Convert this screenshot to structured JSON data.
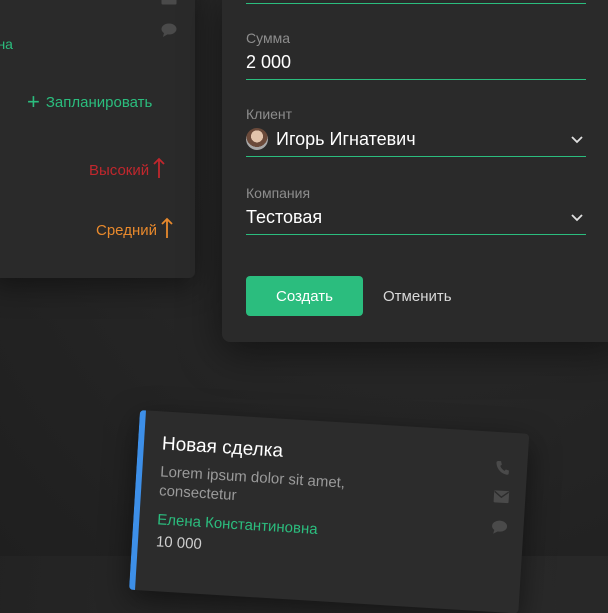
{
  "left_card": {
    "contact_name_partial": "вна",
    "schedule_label": "Запланировать",
    "priority_high": "Высокий",
    "priority_medium": "Средний",
    "colors": {
      "accent": "#2bbd7e",
      "high": "#c0272d",
      "medium": "#e8892c"
    },
    "icons": [
      "mail-icon",
      "chat-icon",
      "plus-icon",
      "arrow-up-icon"
    ]
  },
  "form": {
    "amount": {
      "label": "Сумма",
      "value": "2 000"
    },
    "client": {
      "label": "Клиент",
      "value": "Игорь Игнатевич"
    },
    "company": {
      "label": "Компания",
      "value": "Тестовая"
    },
    "create_label": "Создать",
    "cancel_label": "Отменить",
    "icons": [
      "chevron-down-icon",
      "avatar"
    ]
  },
  "deal_card": {
    "title": "Новая сделка",
    "description": "Lorem ipsum dolor sit amet, consectetur",
    "person": "Елена Константиновна",
    "amount": "10 000",
    "stripe_color": "#3d8fe8",
    "icons": [
      "phone-icon",
      "mail-icon",
      "chat-icon"
    ]
  }
}
